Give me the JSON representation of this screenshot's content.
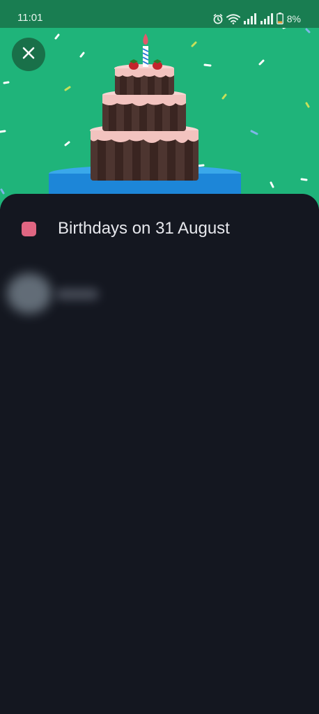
{
  "status_bar": {
    "time": "11:01",
    "battery_percent": "8%",
    "icons": [
      "alarm-icon",
      "wifi-icon",
      "signal-icon",
      "signal-icon",
      "battery-low-icon"
    ]
  },
  "banner": {
    "illustration": "birthday-cake-illustration",
    "background_color": "#1fb47a"
  },
  "close_button": {
    "icon": "close-icon"
  },
  "sheet": {
    "title": "Birthdays on 31 August",
    "calendar_color": "#e06682",
    "contacts": [
      {
        "avatar": "blurred-avatar",
        "name_redacted": true
      }
    ]
  }
}
